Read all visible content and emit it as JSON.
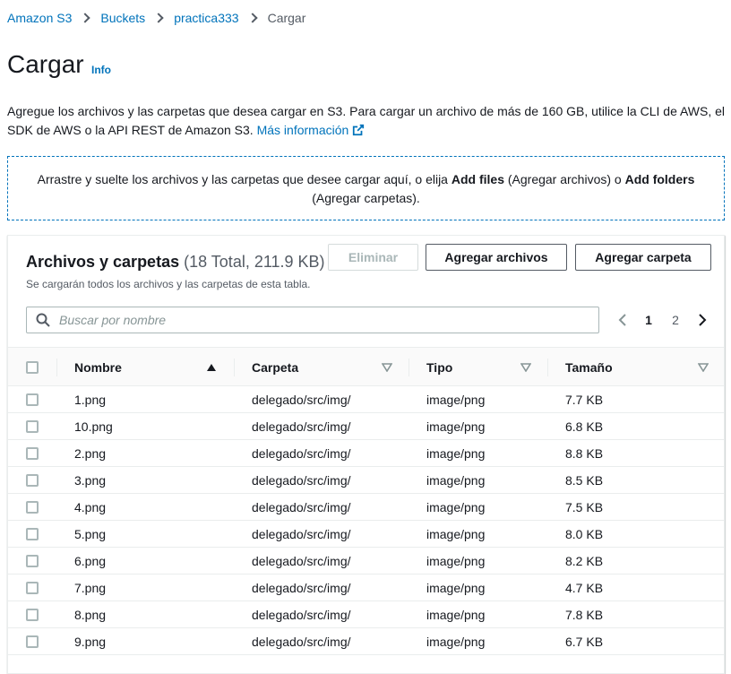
{
  "breadcrumb": {
    "items": [
      "Amazon S3",
      "Buckets",
      "practica333"
    ],
    "current": "Cargar"
  },
  "page": {
    "title": "Cargar",
    "info": "Info",
    "description": "Agregue los archivos y las carpetas que desea cargar en S3. Para cargar un archivo de más de 160 GB, utilice la CLI de AWS, el SDK de AWS o la API REST de Amazon S3.",
    "more_link": "Más información"
  },
  "dropzone": {
    "text_before": "Arrastre y suelte los archivos y las carpetas que desee cargar aquí, o elija ",
    "add_files": "Add files",
    "mid1": " (Agregar archivos) o ",
    "add_folders": "Add folders",
    "text_after": " (Agregar carpetas)."
  },
  "panel": {
    "title": "Archivos y carpetas",
    "count": "(18 Total, 211.9 KB)",
    "subtitle": "Se cargarán todos los archivos y las carpetas de esta tabla.",
    "delete_label": "Eliminar",
    "add_files_label": "Agregar archivos",
    "add_folder_label": "Agregar carpeta",
    "search_placeholder": "Buscar por nombre",
    "pages": [
      "1",
      "2"
    ],
    "current_page": "1"
  },
  "table": {
    "columns": [
      "Nombre",
      "Carpeta",
      "Tipo",
      "Tamaño"
    ],
    "rows": [
      {
        "name": "1.png",
        "folder": "delegado/src/img/",
        "type": "image/png",
        "size": "7.7 KB"
      },
      {
        "name": "10.png",
        "folder": "delegado/src/img/",
        "type": "image/png",
        "size": "6.8 KB"
      },
      {
        "name": "2.png",
        "folder": "delegado/src/img/",
        "type": "image/png",
        "size": "8.8 KB"
      },
      {
        "name": "3.png",
        "folder": "delegado/src/img/",
        "type": "image/png",
        "size": "8.5 KB"
      },
      {
        "name": "4.png",
        "folder": "delegado/src/img/",
        "type": "image/png",
        "size": "7.5 KB"
      },
      {
        "name": "5.png",
        "folder": "delegado/src/img/",
        "type": "image/png",
        "size": "8.0 KB"
      },
      {
        "name": "6.png",
        "folder": "delegado/src/img/",
        "type": "image/png",
        "size": "8.2 KB"
      },
      {
        "name": "7.png",
        "folder": "delegado/src/img/",
        "type": "image/png",
        "size": "4.7 KB"
      },
      {
        "name": "8.png",
        "folder": "delegado/src/img/",
        "type": "image/png",
        "size": "7.8 KB"
      },
      {
        "name": "9.png",
        "folder": "delegado/src/img/",
        "type": "image/png",
        "size": "6.7 KB"
      }
    ]
  },
  "icons": {
    "search": "search-icon",
    "external": "external-link-icon",
    "sort_asc": "sort-ascending-icon",
    "sort": "sort-caret-icon"
  },
  "colors": {
    "link": "#0073bb",
    "text": "#16191f",
    "muted": "#545b64"
  }
}
